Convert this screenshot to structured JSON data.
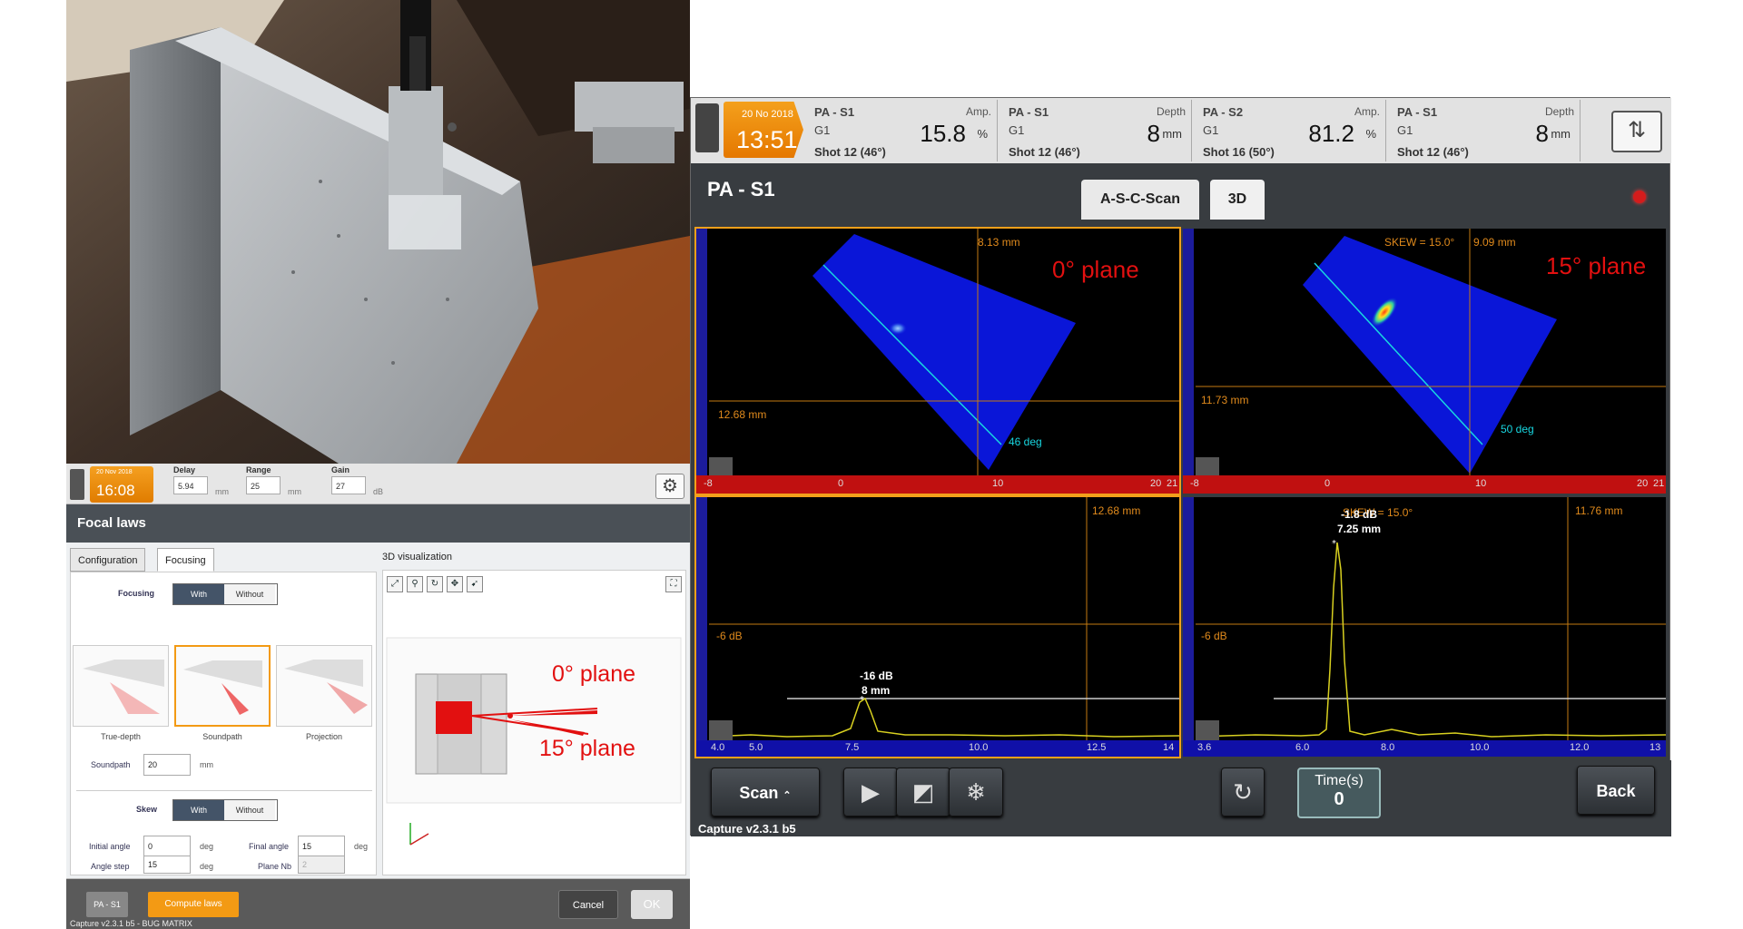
{
  "left_app": {
    "date": "20 Nov 2018",
    "time": "16:08",
    "fields": [
      {
        "label": "Delay",
        "value": "5.94",
        "unit": "mm"
      },
      {
        "label": "Range",
        "value": "25",
        "unit": "mm"
      },
      {
        "label": "Gain",
        "value": "27",
        "unit": "dB"
      }
    ],
    "panel_title": "Focal laws",
    "tabs": [
      "Configuration",
      "Focusing"
    ],
    "viz_title": "3D visualization",
    "focusing_label": "Focusing",
    "toggle_with": "With",
    "toggle_without": "Without",
    "thumbs": [
      "True-depth",
      "Soundpath",
      "Projection"
    ],
    "soundpath_label": "Soundpath",
    "soundpath_value": "20",
    "soundpath_unit": "mm",
    "skew_label": "Skew",
    "initial_angle_label": "Initial angle",
    "initial_angle_value": "0",
    "final_angle_label": "Final angle",
    "final_angle_value": "15",
    "angle_step_label": "Angle step",
    "angle_step_value": "15",
    "plane_nb_label": "Plane Nb",
    "plane_nb_value": "2",
    "deg": "deg",
    "annot_0": "0° plane",
    "annot_15": "15° plane",
    "pa_button": "PA - S1",
    "compute_button": "Compute laws",
    "cancel_button": "Cancel",
    "ok_button": "OK",
    "version": "Capture v2.3.1 b5 - BUG MATRIX"
  },
  "right_app": {
    "date": "20 No 2018",
    "time": "13:51",
    "measures": [
      {
        "name": "PA - S1",
        "type": "Amp.",
        "gate": "G1",
        "value": "15.8",
        "unit": "%",
        "shot": "Shot 12 (46°)"
      },
      {
        "name": "PA - S1",
        "type": "Depth",
        "gate": "G1",
        "value": "8",
        "unit": "mm",
        "shot": "Shot 12 (46°)"
      },
      {
        "name": "PA - S2",
        "type": "Amp.",
        "gate": "G1",
        "value": "81.2",
        "unit": "%",
        "shot": "Shot 16 (50°)"
      },
      {
        "name": "PA - S1",
        "type": "Depth",
        "gate": "G1",
        "value": "8",
        "unit": "mm",
        "shot": "Shot 12 (46°)"
      }
    ],
    "title": "PA - S1",
    "tabs": [
      "A-S-C-Scan",
      "3D"
    ],
    "scan_tl": {
      "depth_label": "8.13 mm",
      "hline_label": "12.68 mm",
      "angle_label": "46 deg",
      "plane_label": "0° plane",
      "axis_ticks": [
        "-8",
        "0",
        "10",
        "20",
        "21"
      ]
    },
    "scan_tr": {
      "skew_label": "SKEW = 15.0°",
      "depth_label": "9.09 mm",
      "hline_label": "11.73 mm",
      "angle_label": "50 deg",
      "plane_label": "15° plane",
      "axis_ticks": [
        "-8",
        "0",
        "10",
        "20",
        "21"
      ]
    },
    "ascan_bl": {
      "depth_label": "12.68 mm",
      "db_label": "-6 dB",
      "peak_db": "-16 dB",
      "peak_mm": "8 mm",
      "axis_ticks": [
        "4.0",
        "5.0",
        "7.5",
        "10.0",
        "12.5",
        "14"
      ]
    },
    "ascan_br": {
      "skew_label": "SKEW = 15.0°",
      "depth_label": "11.76 mm",
      "db_label": "-6 dB",
      "peak_db": "-1.8 dB",
      "peak_mm": "7.25 mm",
      "axis_ticks": [
        "3.6",
        "6.0",
        "8.0",
        "10.0",
        "12.0",
        "13"
      ]
    },
    "scan_button": "Scan",
    "time_label": "Time(s)",
    "time_value": "0",
    "back_button": "Back",
    "version": "Capture v2.3.1 b5"
  }
}
